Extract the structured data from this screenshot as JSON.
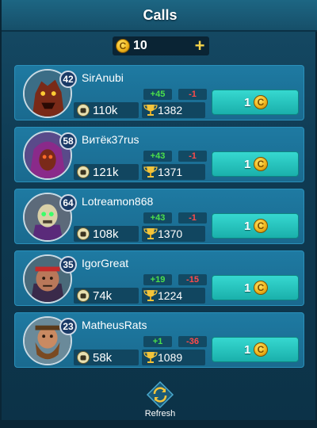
{
  "window": {
    "title": "Calls"
  },
  "balance": {
    "value": "10",
    "plus": "+"
  },
  "players": [
    {
      "name": "SirAnubi",
      "level": "42",
      "power": "110k",
      "win_delta": "+45",
      "lose_delta": "-1",
      "trophies": "1382",
      "call_cost": "1",
      "avatar": "werewolf-avatar"
    },
    {
      "name": "Витёк37rus",
      "level": "58",
      "power": "121k",
      "win_delta": "+43",
      "lose_delta": "-1",
      "trophies": "1371",
      "call_cost": "1",
      "avatar": "hooded-skull-avatar"
    },
    {
      "name": "Lotreamon868",
      "level": "64",
      "power": "108k",
      "win_delta": "+43",
      "lose_delta": "-1",
      "trophies": "1370",
      "call_cost": "1",
      "avatar": "lich-avatar"
    },
    {
      "name": "IgorGreat",
      "level": "35",
      "power": "74k",
      "win_delta": "+19",
      "lose_delta": "-15",
      "trophies": "1224",
      "call_cost": "1",
      "avatar": "brute-avatar"
    },
    {
      "name": "MatheusRats",
      "level": "23",
      "power": "58k",
      "win_delta": "+1",
      "lose_delta": "-36",
      "trophies": "1089",
      "call_cost": "1",
      "avatar": "dwarf-avatar"
    }
  ],
  "refresh": {
    "label": "Refresh"
  },
  "colors": {
    "win": "#4be04b",
    "lose": "#ff4a4a",
    "button": "#2ccdc6",
    "coin": "#f0b51c"
  }
}
